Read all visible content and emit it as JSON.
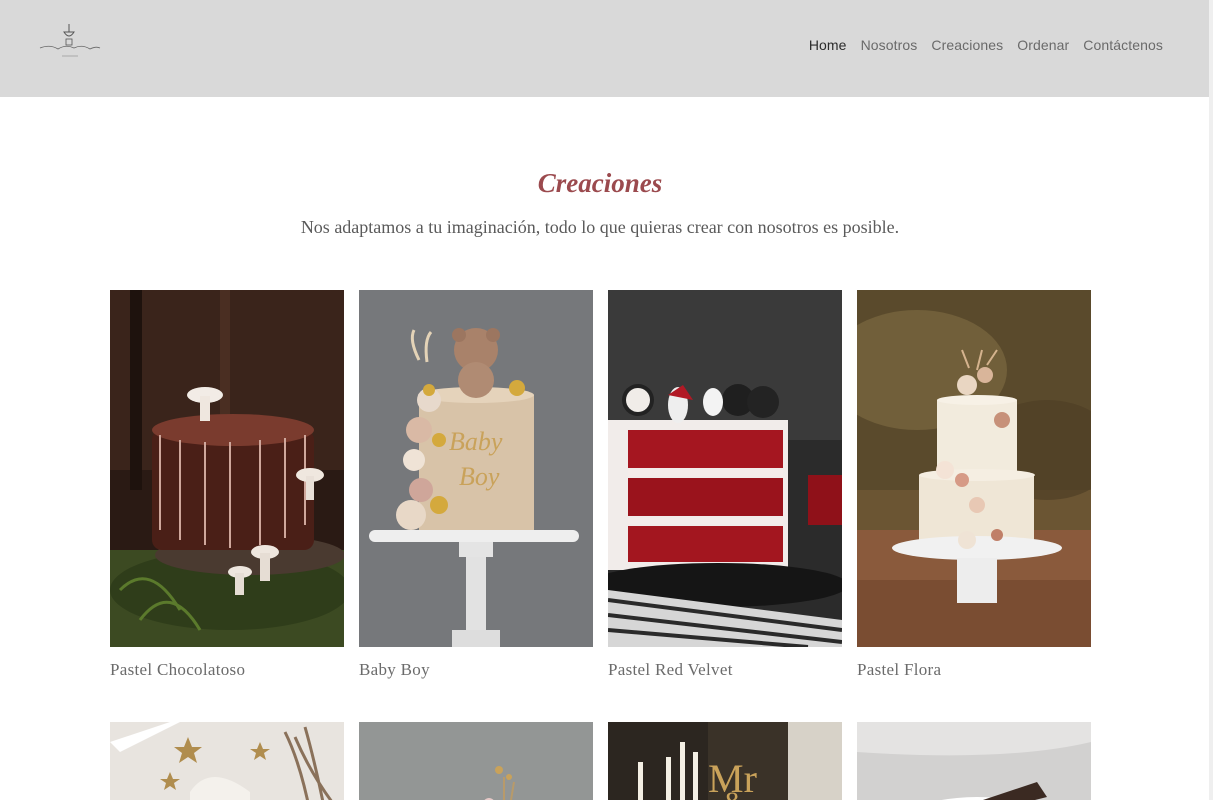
{
  "header": {
    "logo_icon": "cake-stand-logo",
    "nav": [
      {
        "label": "Home",
        "active": true
      },
      {
        "label": "Nosotros",
        "active": false
      },
      {
        "label": "Creaciones",
        "active": false
      },
      {
        "label": "Ordenar",
        "active": false
      },
      {
        "label": "Contáctenos",
        "active": false
      }
    ]
  },
  "section": {
    "title": "Creaciones",
    "subtitle": "Nos adaptamos a tu imaginación, todo lo que quieras crear con nosotros es posible."
  },
  "gallery": {
    "row1": [
      {
        "caption": "Pastel Chocolatoso"
      },
      {
        "caption": "Baby Boy"
      },
      {
        "caption": "Pastel Red Velvet"
      },
      {
        "caption": "Pastel Flora"
      }
    ],
    "row2": [
      {
        "caption": ""
      },
      {
        "caption": ""
      },
      {
        "caption": ""
      },
      {
        "caption": ""
      }
    ]
  },
  "colors": {
    "header_bg": "#d9d9d9",
    "title": "#9b4a4e",
    "text": "#5a5a5a"
  }
}
